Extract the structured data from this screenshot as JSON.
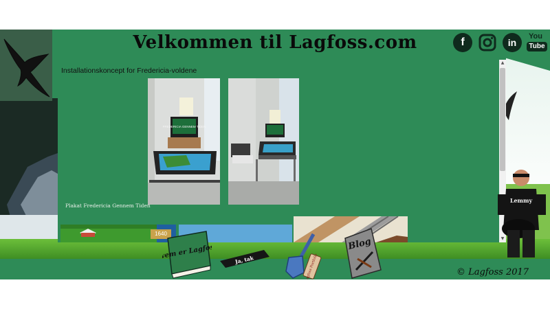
{
  "header": {
    "title": "Velkommen til Lagfoss.com"
  },
  "social": [
    {
      "name": "facebook",
      "label": "f",
      "icon": "facebook-icon"
    },
    {
      "name": "instagram",
      "label": "",
      "icon": "instagram-icon"
    },
    {
      "name": "linkedin",
      "label": "in",
      "icon": "linkedin-icon"
    },
    {
      "name": "youtube",
      "top": "You",
      "bottom": "Tube",
      "icon": "youtube-icon"
    }
  ],
  "content": {
    "heading": "Installationskoncept for Fredericia-voldene",
    "caption": "Plakat Fredericia Gennem Tiden",
    "photo_screen_text": "FREDERICIA GENNEM TIDEN",
    "thumb_year": "1640"
  },
  "nav": {
    "book_label": "Hvem er Lagfoss?",
    "phone_label": "Ja, tak",
    "blog_label": "Blog",
    "sign_label": "Lagfoss Portfolio",
    "shirt_label": "Lemmy"
  },
  "footer": {
    "copyright": "© Lagfoss 2017"
  },
  "colors": {
    "green": "#2e8b57",
    "dark": "#0f2a1d",
    "grass": "#4a9a2c"
  }
}
